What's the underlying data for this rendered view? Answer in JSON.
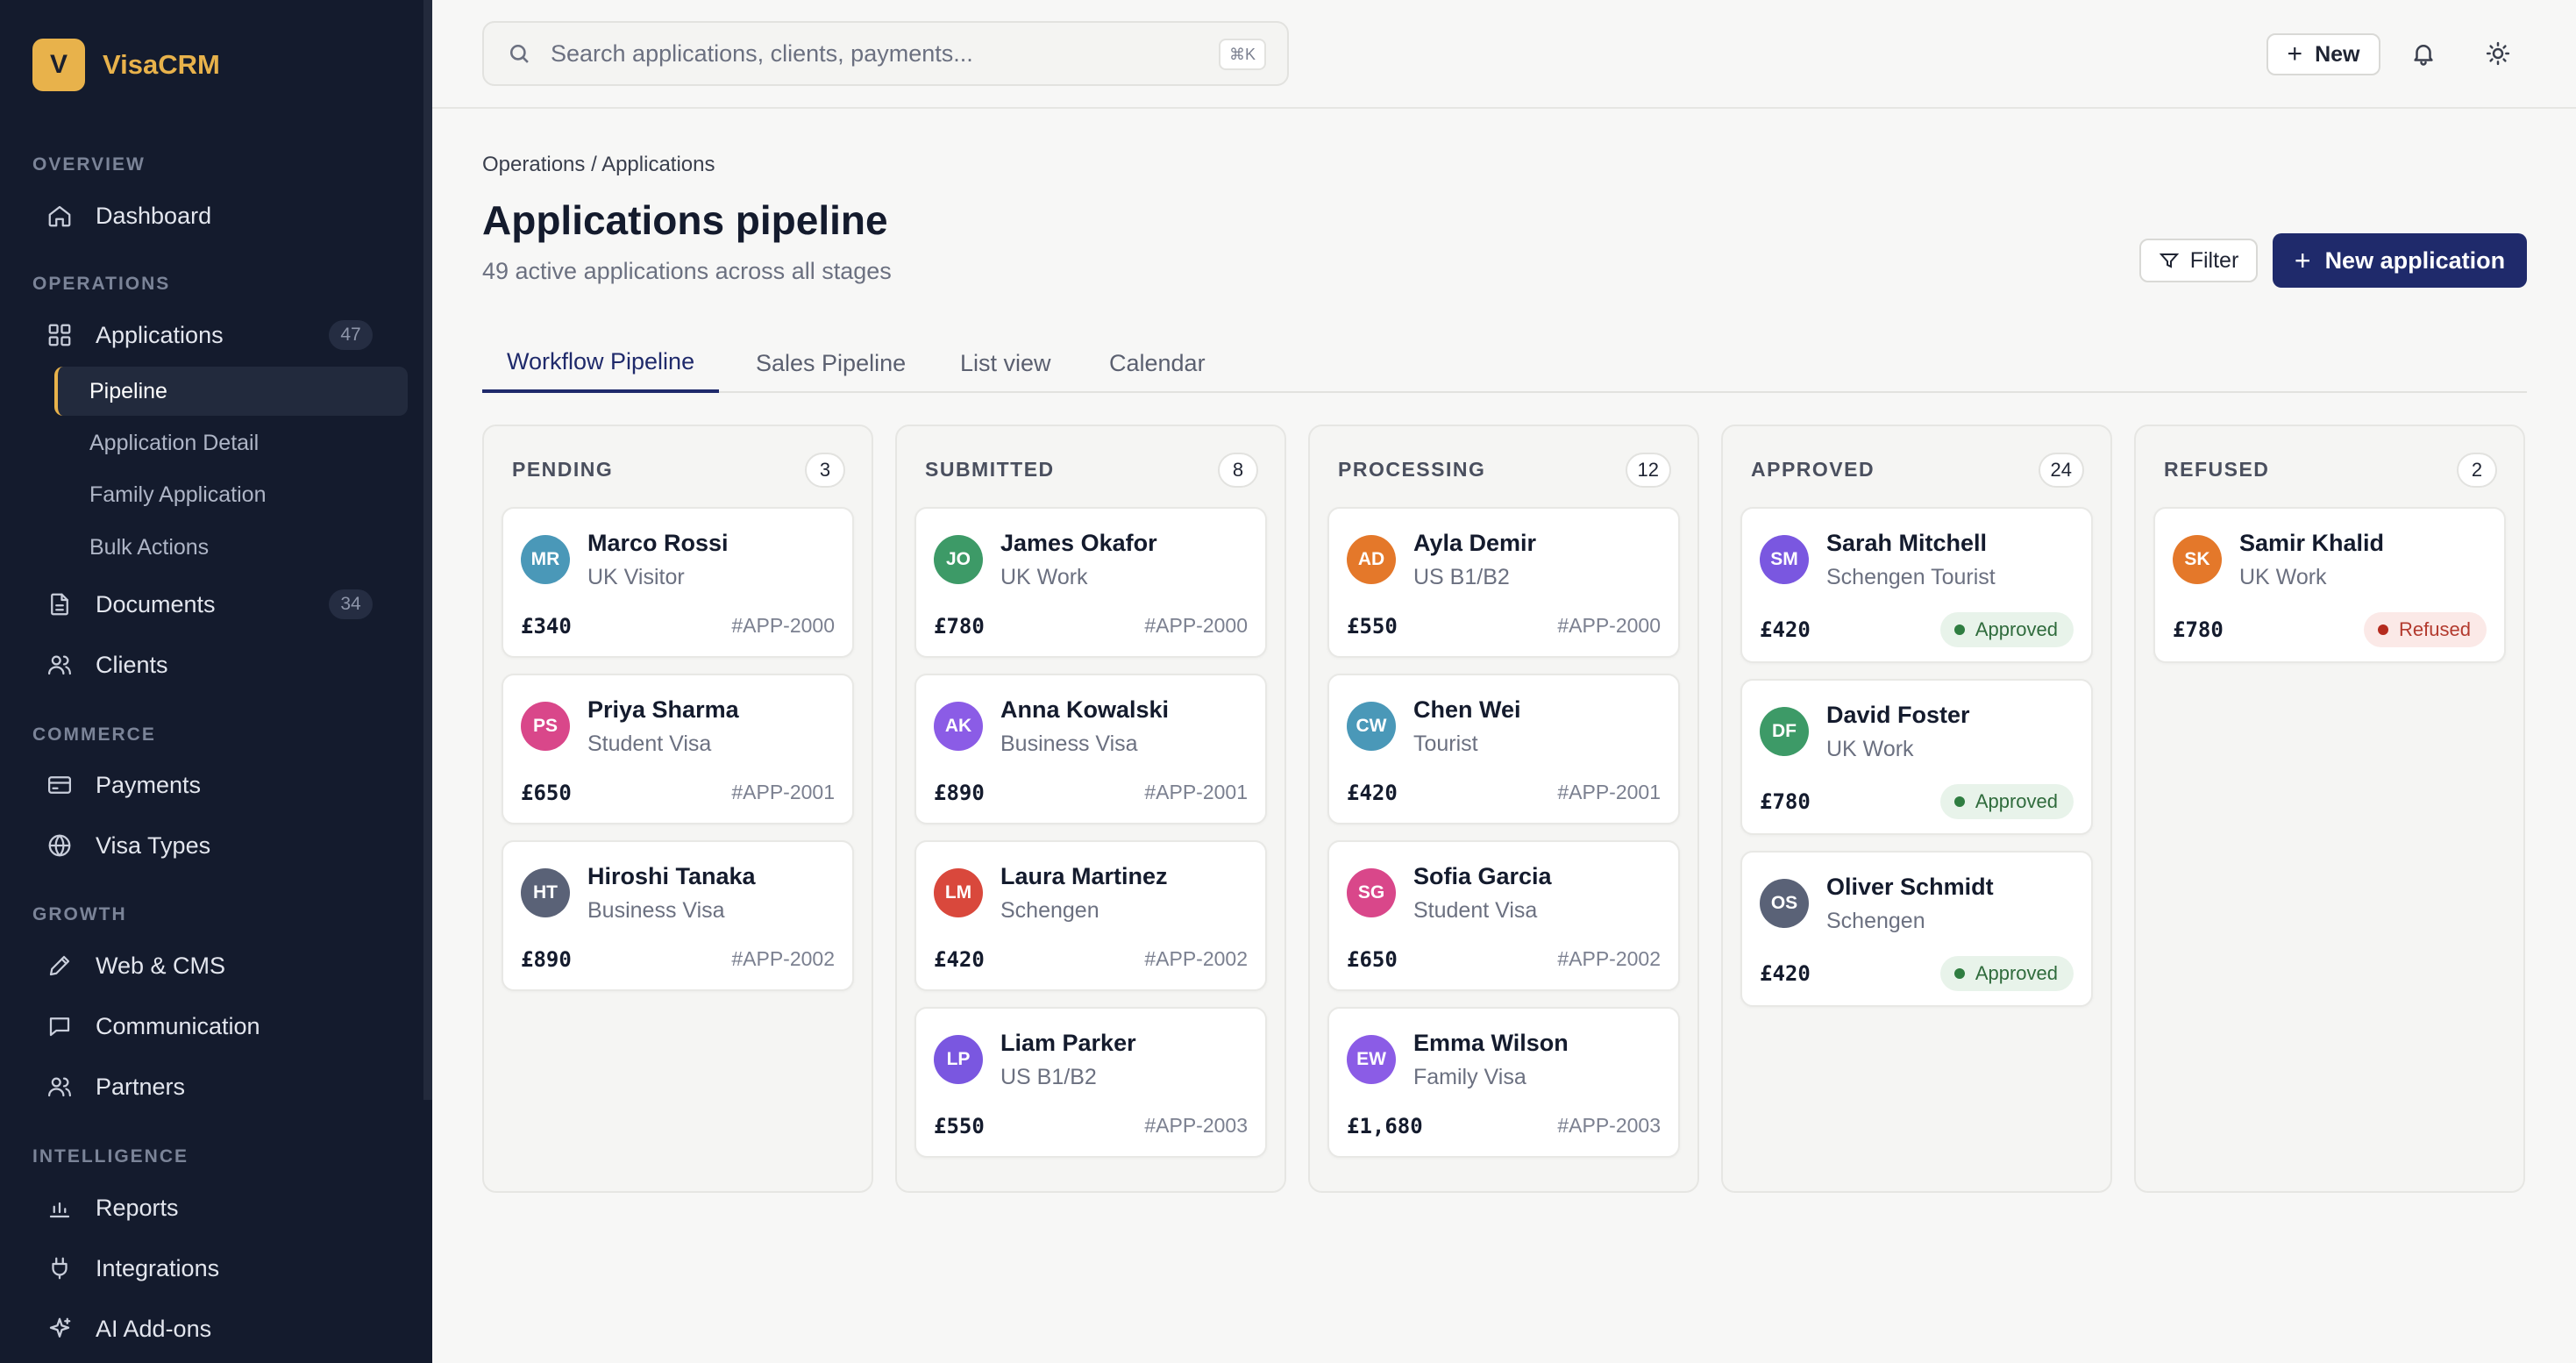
{
  "app": {
    "logo_letter": "V",
    "name": "VisaCRM"
  },
  "sidebar": {
    "sections": [
      "OVERVIEW",
      "OPERATIONS",
      "COMMERCE",
      "GROWTH",
      "INTELLIGENCE"
    ],
    "items": {
      "dashboard": "Dashboard",
      "applications": "Applications",
      "applications_badge": "47",
      "documents": "Documents",
      "documents_badge": "34",
      "clients": "Clients",
      "payments": "Payments",
      "visa_types": "Visa Types",
      "web_cms": "Web & CMS",
      "communication": "Communication",
      "partners": "Partners",
      "reports": "Reports",
      "integrations": "Integrations",
      "ai_addons": "AI Add-ons"
    },
    "subitems": [
      "Pipeline",
      "Application Detail",
      "Family Application",
      "Bulk Actions"
    ]
  },
  "topbar": {
    "search_placeholder": "Search applications, clients, payments...",
    "shortcut": "⌘K",
    "new_label": "New"
  },
  "header": {
    "breadcrumb": "Operations / Applications",
    "title": "Applications pipeline",
    "subtitle": "49 active applications across all stages",
    "filter_label": "Filter",
    "new_app_label": "New application"
  },
  "tabs": [
    "Workflow Pipeline",
    "Sales Pipeline",
    "List view",
    "Calendar"
  ],
  "columns": [
    {
      "title": "PENDING",
      "count": "3",
      "cards": [
        {
          "initials": "MR",
          "name": "Marco Rossi",
          "type": "UK Visitor",
          "price": "£340",
          "id": "#APP-2000",
          "color": "#4a98b8"
        },
        {
          "initials": "PS",
          "name": "Priya Sharma",
          "type": "Student Visa",
          "price": "£650",
          "id": "#APP-2001",
          "color": "#d9478a"
        },
        {
          "initials": "HT",
          "name": "Hiroshi Tanaka",
          "type": "Business Visa",
          "price": "£890",
          "id": "#APP-2002",
          "color": "#5a6277"
        }
      ]
    },
    {
      "title": "SUBMITTED",
      "count": "8",
      "cards": [
        {
          "initials": "JO",
          "name": "James Okafor",
          "type": "UK Work",
          "price": "£780",
          "id": "#APP-2000",
          "color": "#3d9a67"
        },
        {
          "initials": "AK",
          "name": "Anna Kowalski",
          "type": "Business Visa",
          "price": "£890",
          "id": "#APP-2001",
          "color": "#8b5ce6"
        },
        {
          "initials": "LM",
          "name": "Laura Martinez",
          "type": "Schengen",
          "price": "£420",
          "id": "#APP-2002",
          "color": "#d9483c"
        },
        {
          "initials": "LP",
          "name": "Liam Parker",
          "type": "US B1/B2",
          "price": "£550",
          "id": "#APP-2003",
          "color": "#7a57e0"
        }
      ]
    },
    {
      "title": "PROCESSING",
      "count": "12",
      "cards": [
        {
          "initials": "AD",
          "name": "Ayla Demir",
          "type": "US B1/B2",
          "price": "£550",
          "id": "#APP-2000",
          "color": "#e4782a"
        },
        {
          "initials": "CW",
          "name": "Chen Wei",
          "type": "Tourist",
          "price": "£420",
          "id": "#APP-2001",
          "color": "#4a98b8"
        },
        {
          "initials": "SG",
          "name": "Sofia Garcia",
          "type": "Student Visa",
          "price": "£650",
          "id": "#APP-2002",
          "color": "#d9478a"
        },
        {
          "initials": "EW",
          "name": "Emma Wilson",
          "type": "Family Visa",
          "price": "£1,680",
          "id": "#APP-2003",
          "color": "#8b5ce6"
        }
      ]
    },
    {
      "title": "APPROVED",
      "count": "24",
      "cards": [
        {
          "initials": "SM",
          "name": "Sarah Mitchell",
          "type": "Schengen Tourist",
          "price": "£420",
          "status": "Approved",
          "color": "#7a57e0"
        },
        {
          "initials": "DF",
          "name": "David Foster",
          "type": "UK Work",
          "price": "£780",
          "status": "Approved",
          "color": "#3d9a67"
        },
        {
          "initials": "OS",
          "name": "Oliver Schmidt",
          "type": "Schengen",
          "price": "£420",
          "status": "Approved",
          "color": "#5a6277"
        }
      ]
    },
    {
      "title": "REFUSED",
      "count": "2",
      "cards": [
        {
          "initials": "SK",
          "name": "Samir Khalid",
          "type": "UK Work",
          "price": "£780",
          "status": "Refused",
          "color": "#e4782a"
        }
      ]
    }
  ]
}
